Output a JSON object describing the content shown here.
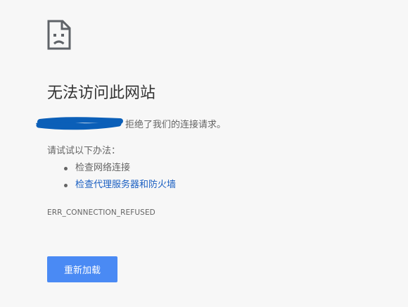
{
  "error": {
    "icon": "sad-page-icon",
    "title": "无法访问此网站",
    "refused_suffix": "拒绝了我们的连接请求。",
    "suggest_intro": "请试试以下办法：",
    "suggestions": [
      {
        "label": "检查网络连接",
        "is_link": false
      },
      {
        "label": "检查代理服务器和防火墙",
        "is_link": true
      }
    ],
    "code": "ERR_CONNECTION_REFUSED",
    "reload_label": "重新加载"
  },
  "colors": {
    "background": "#f7f7f7",
    "title": "#333333",
    "body_text": "#646464",
    "link": "#1a5fc2",
    "button": "#4a8af4",
    "redaction": "#0b5fb8"
  }
}
